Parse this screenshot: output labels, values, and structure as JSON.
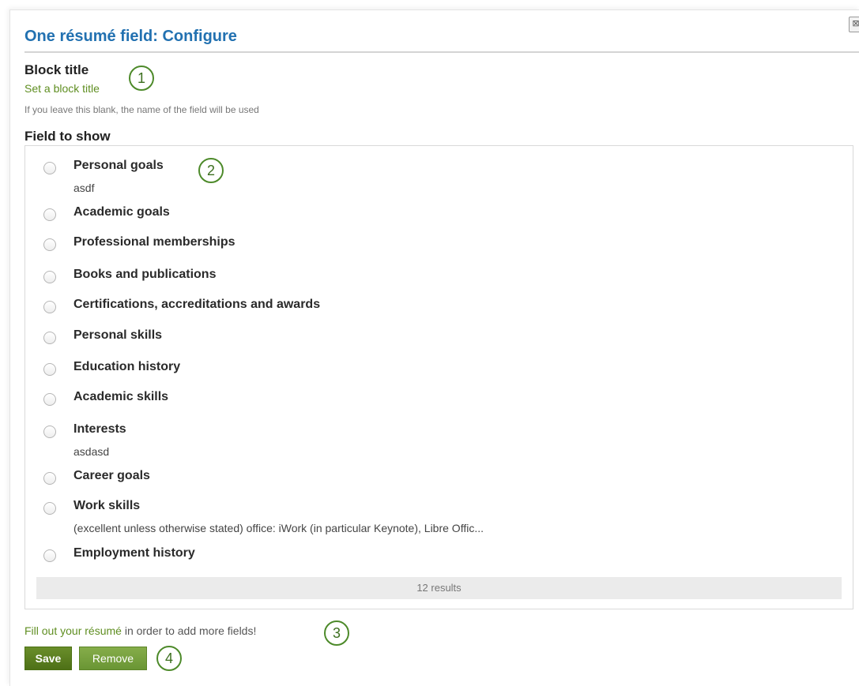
{
  "dialog": {
    "title": "One résumé field: Configure",
    "close_glyph": "⊠"
  },
  "block_title": {
    "label": "Block title",
    "value_placeholder": "Set a block title",
    "hint": "If you leave this blank, the name of the field will be used"
  },
  "field_to_show": {
    "label": "Field to show",
    "options": [
      {
        "label": "Personal goals",
        "desc": "asdf"
      },
      {
        "label": "Academic goals",
        "desc": ""
      },
      {
        "label": "Professional memberships",
        "desc": ""
      },
      {
        "label": "Books and publications",
        "desc": ""
      },
      {
        "label": "Certifications, accreditations and awards",
        "desc": ""
      },
      {
        "label": "Personal skills",
        "desc": ""
      },
      {
        "label": "Education history",
        "desc": ""
      },
      {
        "label": "Academic skills",
        "desc": ""
      },
      {
        "label": "Interests",
        "desc": "asdasd"
      },
      {
        "label": "Career goals",
        "desc": ""
      },
      {
        "label": "Work skills",
        "desc": "(excellent unless otherwise stated) office: iWork (in particular Keynote), Libre Offic..."
      },
      {
        "label": "Employment history",
        "desc": ""
      }
    ],
    "results_text": "12 results"
  },
  "footer": {
    "fillout_link": "Fill out your résumé",
    "fillout_rest": " in order to add more fields!",
    "save_label": "Save",
    "remove_label": "Remove"
  },
  "callouts": [
    "1",
    "2",
    "3",
    "4"
  ],
  "colors": {
    "title_blue": "#2271b1",
    "link_green": "#5f8e21",
    "button_green": "#5a7f1f",
    "callout_green": "#4d8a2a"
  }
}
